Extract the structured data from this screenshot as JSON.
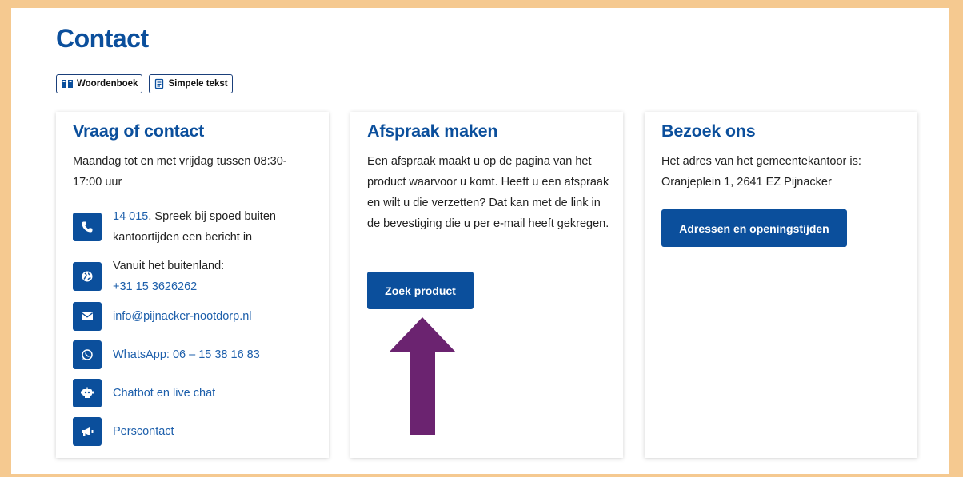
{
  "page": {
    "title": "Contact"
  },
  "tools": {
    "dictionary_label": "Woordenboek",
    "simple_text_label": "Simpele tekst"
  },
  "cards": {
    "contact": {
      "title": "Vraag of contact",
      "hours": "Maandag tot en met vrijdag tussen 08:30-17:00 uur",
      "phone_number": "14 015",
      "phone_text": ". Spreek bij spoed buiten kantoortijden een bericht in",
      "abroad_text": "Vanuit het buitenland:",
      "abroad_number": "+31 15 3626262",
      "email": "info@pijnacker-nootdorp.nl",
      "whatsapp": "WhatsApp: 06 – 15 38 16 83",
      "chatbot": "Chatbot en live chat",
      "press": "Perscontact"
    },
    "appointment": {
      "title": "Afspraak maken",
      "text": "Een afspraak maakt u op de pagina van het product waarvoor u komt. Heeft u een afspraak en wilt u die verzetten? Dat kan met de link in de bevestiging die u per e-mail heeft gekregen.",
      "button": "Zoek product"
    },
    "visit": {
      "title": "Bezoek ons",
      "text": "Het adres van het gemeentekantoor is: Oranjeplein 1, 2641 EZ Pijnacker",
      "button": "Adressen en openingstijden"
    }
  },
  "colors": {
    "brand": "#0b4f9c",
    "frame": "#f5c990",
    "annotation_arrow": "#6b2370"
  },
  "icons": [
    "book-icon",
    "document-icon",
    "phone-icon",
    "globe-icon",
    "mail-icon",
    "whatsapp-icon",
    "chatbot-icon",
    "megaphone-icon"
  ]
}
